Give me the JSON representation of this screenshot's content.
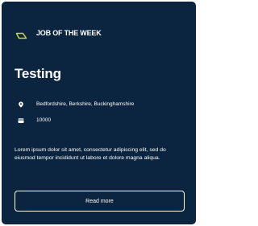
{
  "card": {
    "kicker": {
      "label": "JOB OF THE WEEK",
      "icon": "tag-icon",
      "icon_color": "#c7d82b"
    },
    "title": "Testing",
    "location": {
      "icon": "location-pin-icon",
      "text": "Bedfordshire, Berkshire, Buckinghamshire"
    },
    "salary": {
      "icon": "wallet-icon",
      "text": "10000"
    },
    "description": "Lorem ipsum dolor sit amet, consectetur adipiscing elit, sed do eiusmod tempor incididunt ut labore et dolore magna aliqua.",
    "button": {
      "label": "Read more"
    }
  },
  "colors": {
    "card_background": "#0b2440",
    "text": "#ffffff",
    "accent": "#c7d82b"
  }
}
